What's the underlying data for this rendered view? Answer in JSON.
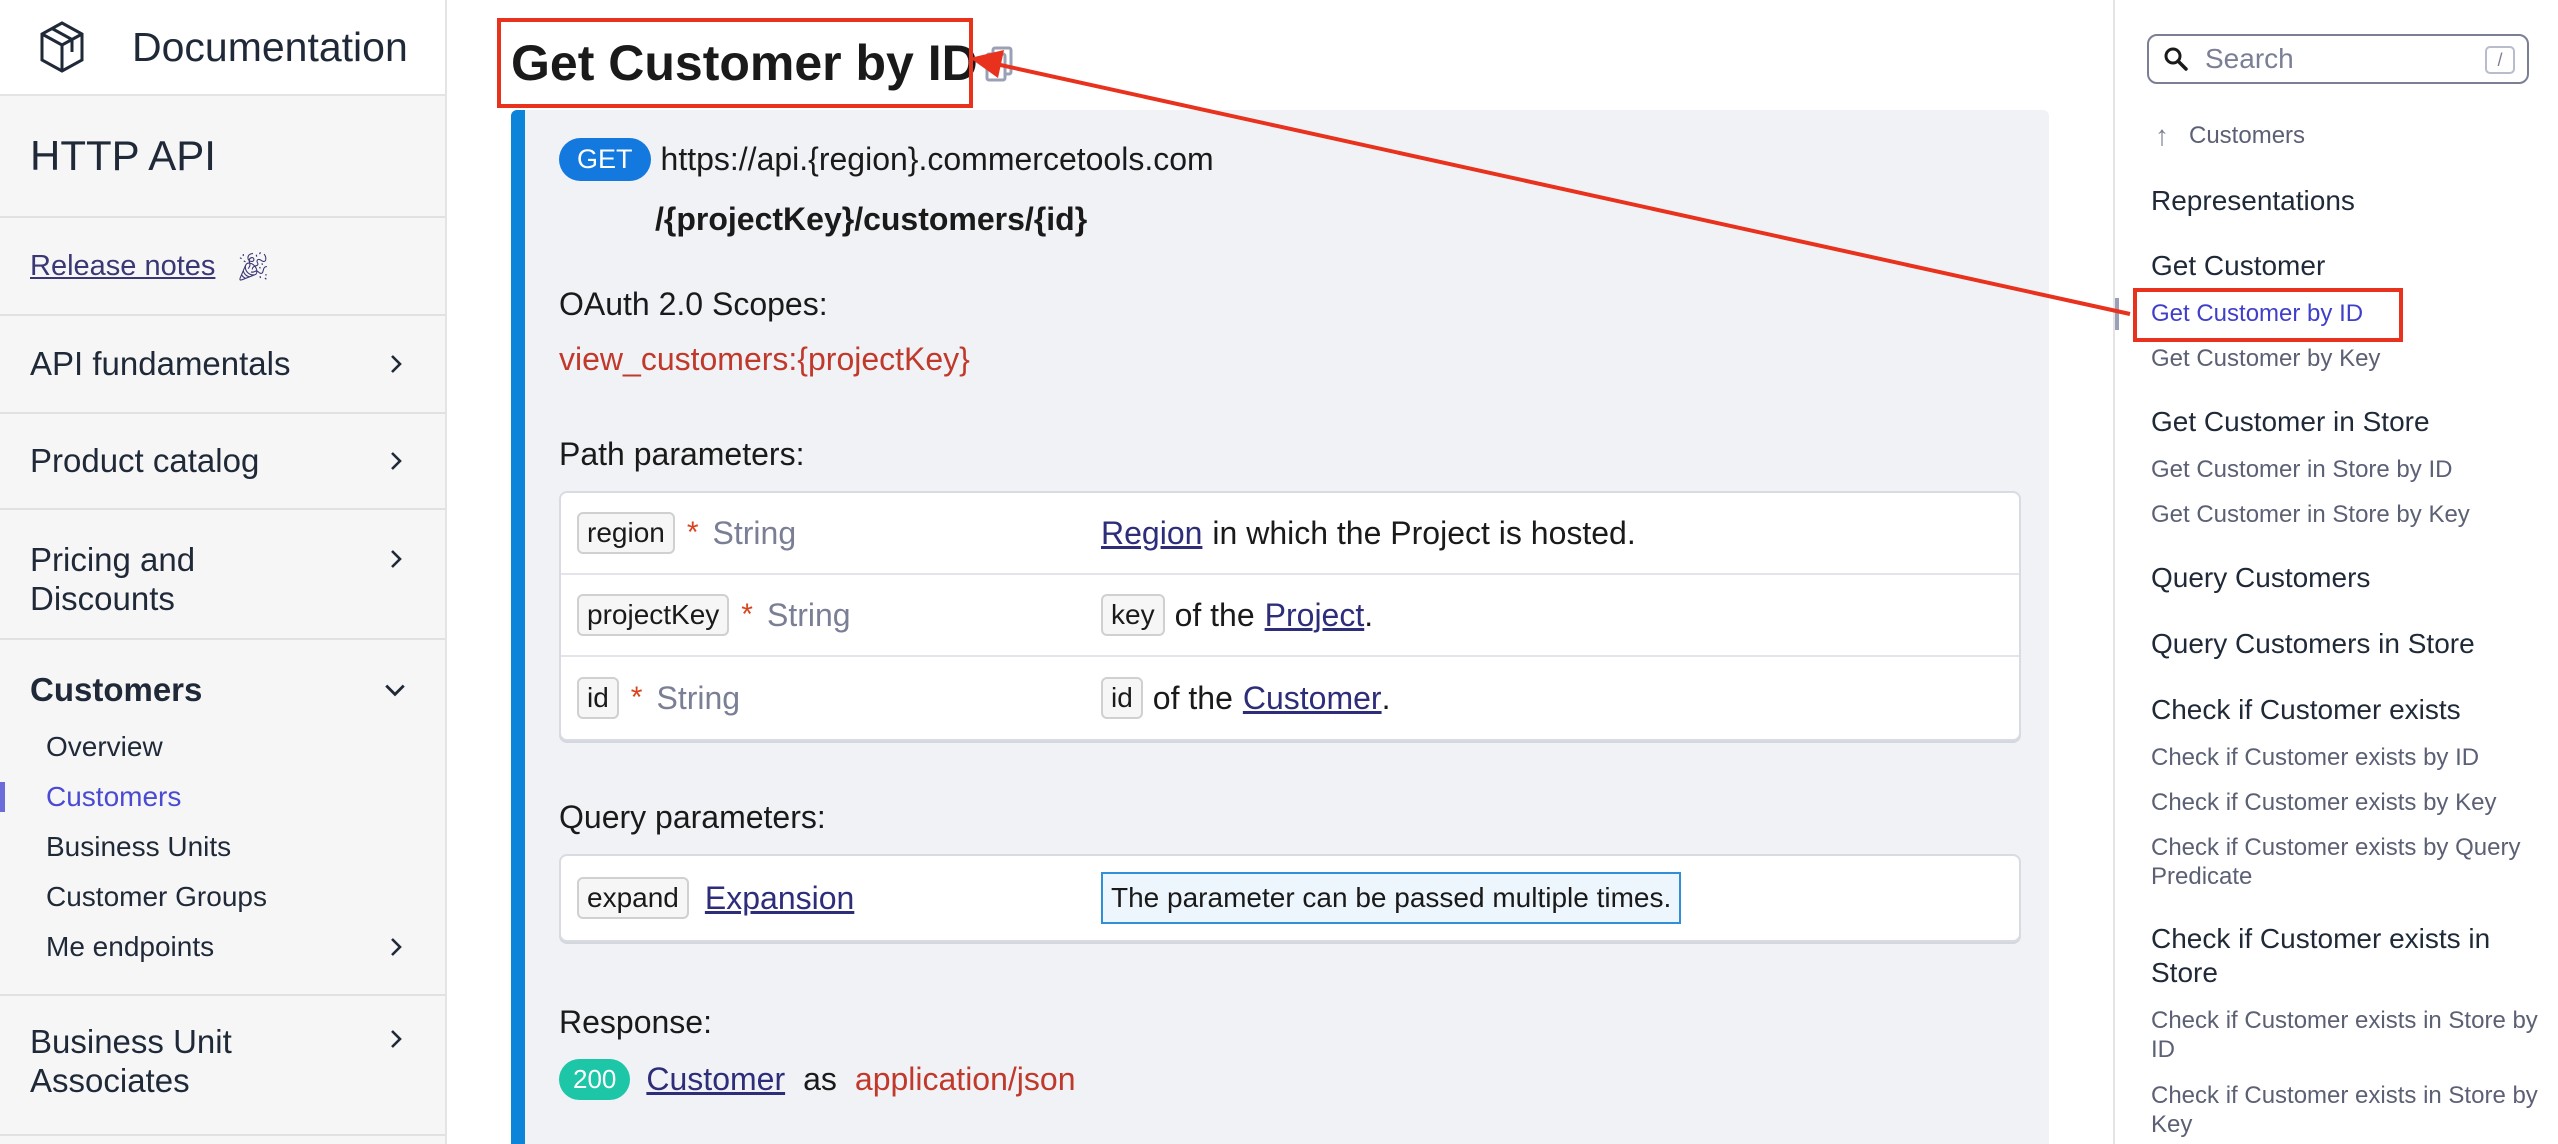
{
  "app": {
    "title": "Documentation"
  },
  "sidebar": {
    "section_title": "HTTP API",
    "release_notes": "Release notes",
    "items": [
      {
        "label": "API fundamentals"
      },
      {
        "label": "Product catalog"
      },
      {
        "label": "Pricing and Discounts"
      },
      {
        "label": "Customers"
      },
      {
        "label": "Business Unit Associates"
      }
    ],
    "customers_children": [
      {
        "label": "Overview"
      },
      {
        "label": "Customers"
      },
      {
        "label": "Business Units"
      },
      {
        "label": "Customer Groups"
      },
      {
        "label": "Me endpoints"
      }
    ]
  },
  "main": {
    "title": "Get Customer by ID",
    "method": "GET",
    "url_host": "https://api.{region}.commercetools.com",
    "url_path": "/{projectKey}/customers/{id}",
    "oauth_label": "OAuth 2.0 Scopes:",
    "scope": "view_customers:{projectKey}",
    "path_params_label": "Path parameters:",
    "path_params": [
      {
        "name": "region",
        "required": "*",
        "type": "String",
        "desc_link": "Region",
        "desc_text": "in which the Project is hosted."
      },
      {
        "name": "projectKey",
        "required": "*",
        "type": "String",
        "desc_code": "key",
        "desc_mid": "of the",
        "desc_link": "Project",
        "desc_end": "."
      },
      {
        "name": "id",
        "required": "*",
        "type": "String",
        "desc_code": "id",
        "desc_mid": "of the",
        "desc_link": "Customer",
        "desc_end": "."
      }
    ],
    "query_params_label": "Query parameters:",
    "query_params": [
      {
        "name": "expand",
        "type_link": "Expansion",
        "note": "The parameter can be passed multiple times."
      }
    ],
    "response_label": "Response:",
    "response": {
      "status": "200",
      "type_link": "Customer",
      "as": "as",
      "mime": "application/json"
    }
  },
  "toc": {
    "search_placeholder": "Search",
    "search_shortcut": "/",
    "back_label": "Customers",
    "entries": [
      {
        "text": "Representations",
        "level": "h"
      },
      {
        "text": "Get Customer",
        "level": "h"
      },
      {
        "text": "Get Customer by ID",
        "level": "s",
        "active": true
      },
      {
        "text": "Get Customer by Key",
        "level": "s"
      },
      {
        "text": "Get Customer in Store",
        "level": "h"
      },
      {
        "text": "Get Customer in Store by ID",
        "level": "s"
      },
      {
        "text": "Get Customer in Store by Key",
        "level": "s"
      },
      {
        "text": "Query Customers",
        "level": "h"
      },
      {
        "text": "Query Customers in Store",
        "level": "h"
      },
      {
        "text": "Check if Customer exists",
        "level": "h"
      },
      {
        "text": "Check if Customer exists by ID",
        "level": "s"
      },
      {
        "text": "Check if Customer exists by Key",
        "level": "s"
      },
      {
        "text": "Check if Customer exists by Query Predicate",
        "level": "s"
      },
      {
        "text": "Check if Customer exists in Store",
        "level": "h"
      },
      {
        "text": "Check if Customer exists in Store by ID",
        "level": "s"
      },
      {
        "text": "Check if Customer exists in Store by Key",
        "level": "s"
      }
    ]
  },
  "colors": {
    "accent": "#0b84d9",
    "annotation": "#e8321d",
    "scope_red": "#c0392b",
    "status_green": "#1cc6a6",
    "active_link": "#4a4bd1"
  }
}
